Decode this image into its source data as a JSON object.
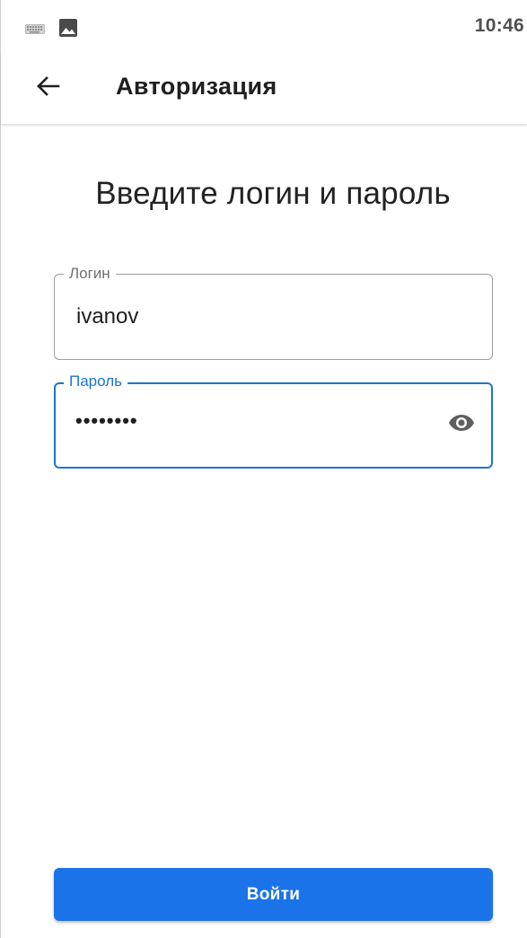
{
  "status_bar": {
    "time": "10:46",
    "icons": [
      "keyboard-icon",
      "image-icon"
    ]
  },
  "app_bar": {
    "title": "Авторизация",
    "back_icon": "arrow-left-icon"
  },
  "form": {
    "heading": "Введите логин и пароль",
    "login": {
      "label": "Логин",
      "value": "ivanov"
    },
    "password": {
      "label": "Пароль",
      "value": "••••••••",
      "toggle_icon": "eye-icon",
      "focused": true
    },
    "submit_label": "Войти"
  },
  "colors": {
    "accent": "#1976d2",
    "button": "#1a73e8",
    "outline": "#9e9e9e"
  }
}
